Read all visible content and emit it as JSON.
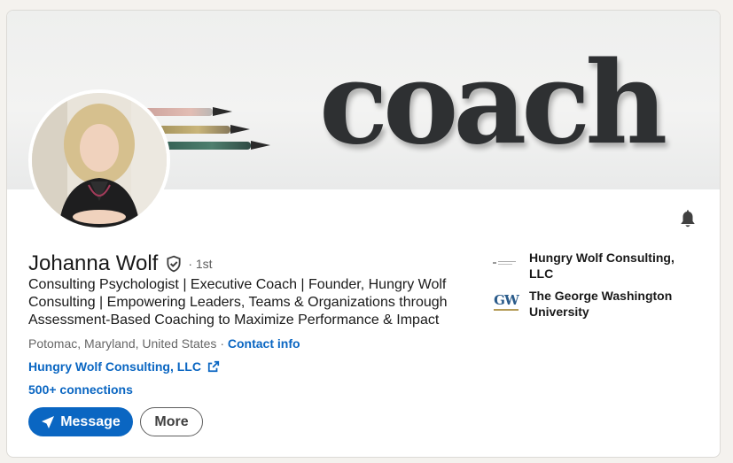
{
  "banner": {
    "word": "coach"
  },
  "profile": {
    "name": "Johanna Wolf",
    "degree": "· 1st",
    "headline": "Consulting Psychologist | Executive Coach | Founder, Hungry Wolf Consulting | Empowering Leaders, Teams & Organizations through Assessment-Based Coaching to Maximize Performance & Impact",
    "location": "Potomac, Maryland, United States",
    "location_separator": " · ",
    "contact_info": "Contact info",
    "website": "Hungry Wolf Consulting, LLC",
    "connections": "500+ connections"
  },
  "actions": {
    "message": "Message",
    "more": "More"
  },
  "organizations": [
    {
      "name": "Hungry Wolf Consulting, LLC",
      "logo": "hungry-wolf-logo"
    },
    {
      "name": "The George Washington University",
      "logo_text": "GW"
    }
  ],
  "colors": {
    "accent": "#0a66c2",
    "text": "#191919",
    "muted": "#666666",
    "background": "#f4f2ee"
  },
  "icons": {
    "notifications": "bell-icon",
    "verified": "shield-check-icon",
    "external": "external-link-icon",
    "send": "paper-plane-icon"
  }
}
